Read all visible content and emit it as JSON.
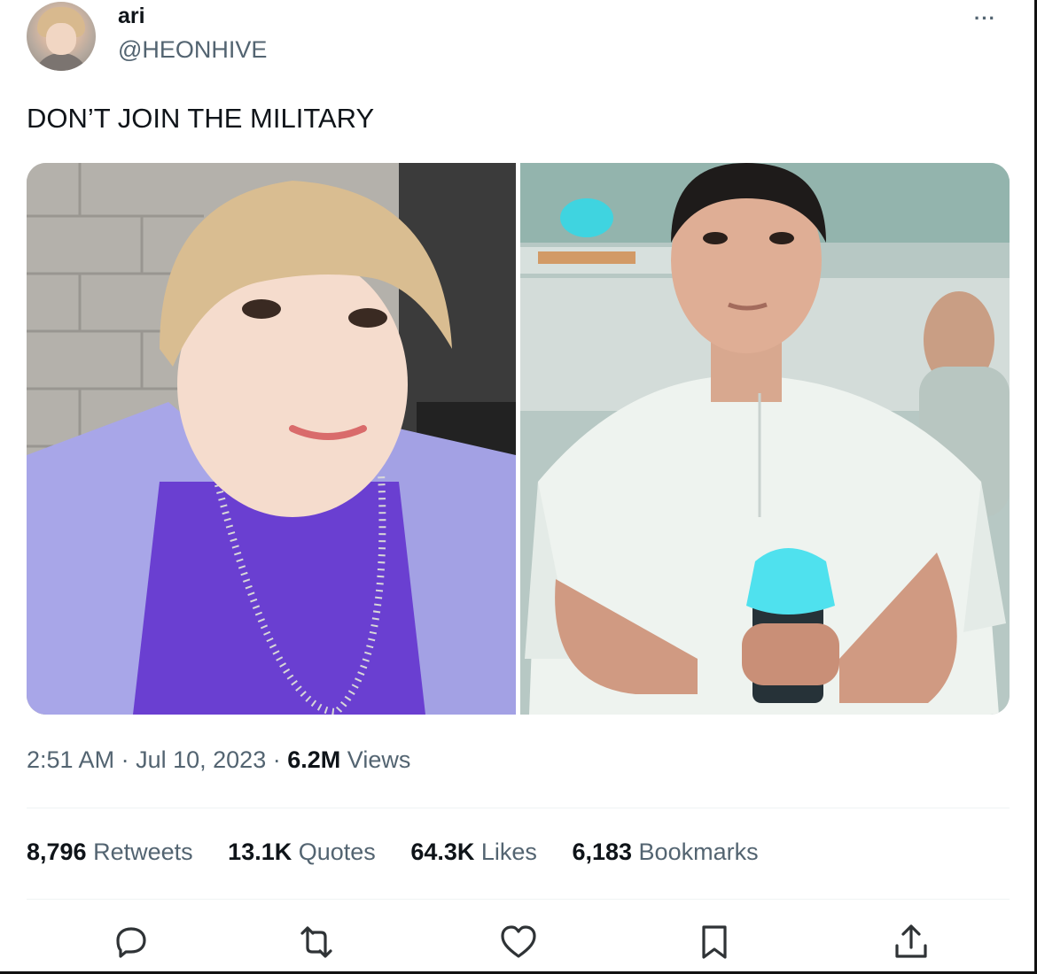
{
  "user": {
    "name": "ari",
    "handle": "@HEONHIVE"
  },
  "tweet": {
    "text": "DON’T JOIN THE MILITARY"
  },
  "meta": {
    "time": "2:51 AM",
    "sep1": "·",
    "date": "Jul 10, 2023",
    "sep2": "·",
    "views_count": "6.2M",
    "views_label": "Views"
  },
  "stats": [
    {
      "count": "8,796",
      "label": "Retweets"
    },
    {
      "count": "13.1K",
      "label": "Quotes"
    },
    {
      "count": "64.3K",
      "label": "Likes"
    },
    {
      "count": "6,183",
      "label": "Bookmarks"
    }
  ],
  "more_label": "···",
  "icons": {
    "reply": "reply-icon",
    "retweet": "retweet-icon",
    "like": "heart-icon",
    "bookmark": "bookmark-icon",
    "share": "share-icon"
  },
  "colors": {
    "text": "#0f1419",
    "secondary": "#536471",
    "divider": "#eff3f4"
  }
}
